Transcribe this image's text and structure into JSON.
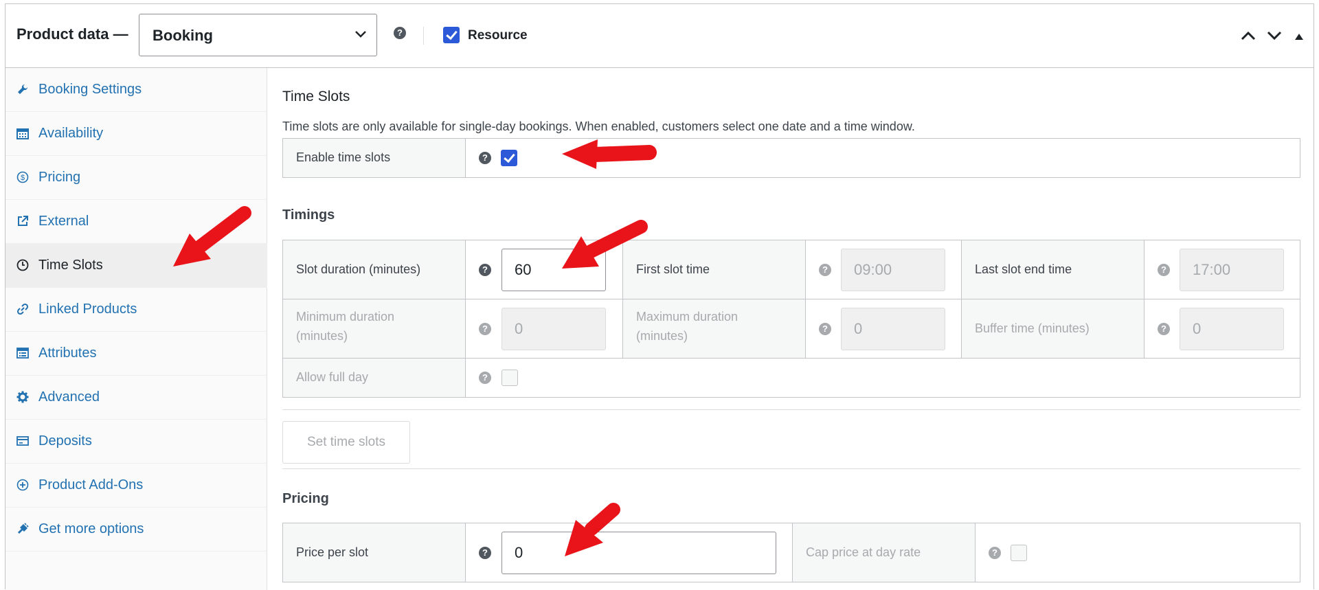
{
  "header": {
    "title": "Product data —",
    "product_type": "Booking",
    "resource_label": "Resource",
    "resource_checked": true
  },
  "sidebar": {
    "items": [
      {
        "label": "Booking Settings",
        "icon": "wrench-icon"
      },
      {
        "label": "Availability",
        "icon": "calendar-icon"
      },
      {
        "label": "Pricing",
        "icon": "dollar-circle-icon"
      },
      {
        "label": "External",
        "icon": "external-link-icon"
      },
      {
        "label": "Time Slots",
        "icon": "clock-icon",
        "active": true
      },
      {
        "label": "Linked Products",
        "icon": "link-icon"
      },
      {
        "label": "Attributes",
        "icon": "attributes-list-icon"
      },
      {
        "label": "Advanced",
        "icon": "gear-icon"
      },
      {
        "label": "Deposits",
        "icon": "card-icon"
      },
      {
        "label": "Product Add-Ons",
        "icon": "plus-circle-icon"
      },
      {
        "label": "Get more options",
        "icon": "plugin-icon"
      }
    ]
  },
  "time_slots": {
    "title": "Time Slots",
    "description": "Time slots are only available for single-day bookings. When enabled, customers select one date and a time window.",
    "enable_label": "Enable time slots",
    "enable_checked": true
  },
  "timings": {
    "title": "Timings",
    "slot_duration_label": "Slot duration (minutes)",
    "slot_duration_value": "60",
    "first_slot_label": "First slot time",
    "first_slot_placeholder": "09:00",
    "last_slot_label": "Last slot end time",
    "last_slot_placeholder": "17:00",
    "min_duration_label_1": "Minimum duration",
    "min_duration_label_2": "(minutes)",
    "min_duration_placeholder": "0",
    "max_duration_label_1": "Maximum duration",
    "max_duration_label_2": "(minutes)",
    "max_duration_placeholder": "0",
    "buffer_label": "Buffer time (minutes)",
    "buffer_placeholder": "0",
    "allow_full_day_label": "Allow full day",
    "allow_full_day_checked": false,
    "set_button": "Set time slots"
  },
  "pricing": {
    "title": "Pricing",
    "price_label": "Price per slot",
    "price_value": "0",
    "cap_label": "Cap price at day rate",
    "cap_checked": false
  },
  "colors": {
    "link": "#2271b1",
    "checkbox": "#2b59d8",
    "annotation_arrow": "#e8141a"
  }
}
